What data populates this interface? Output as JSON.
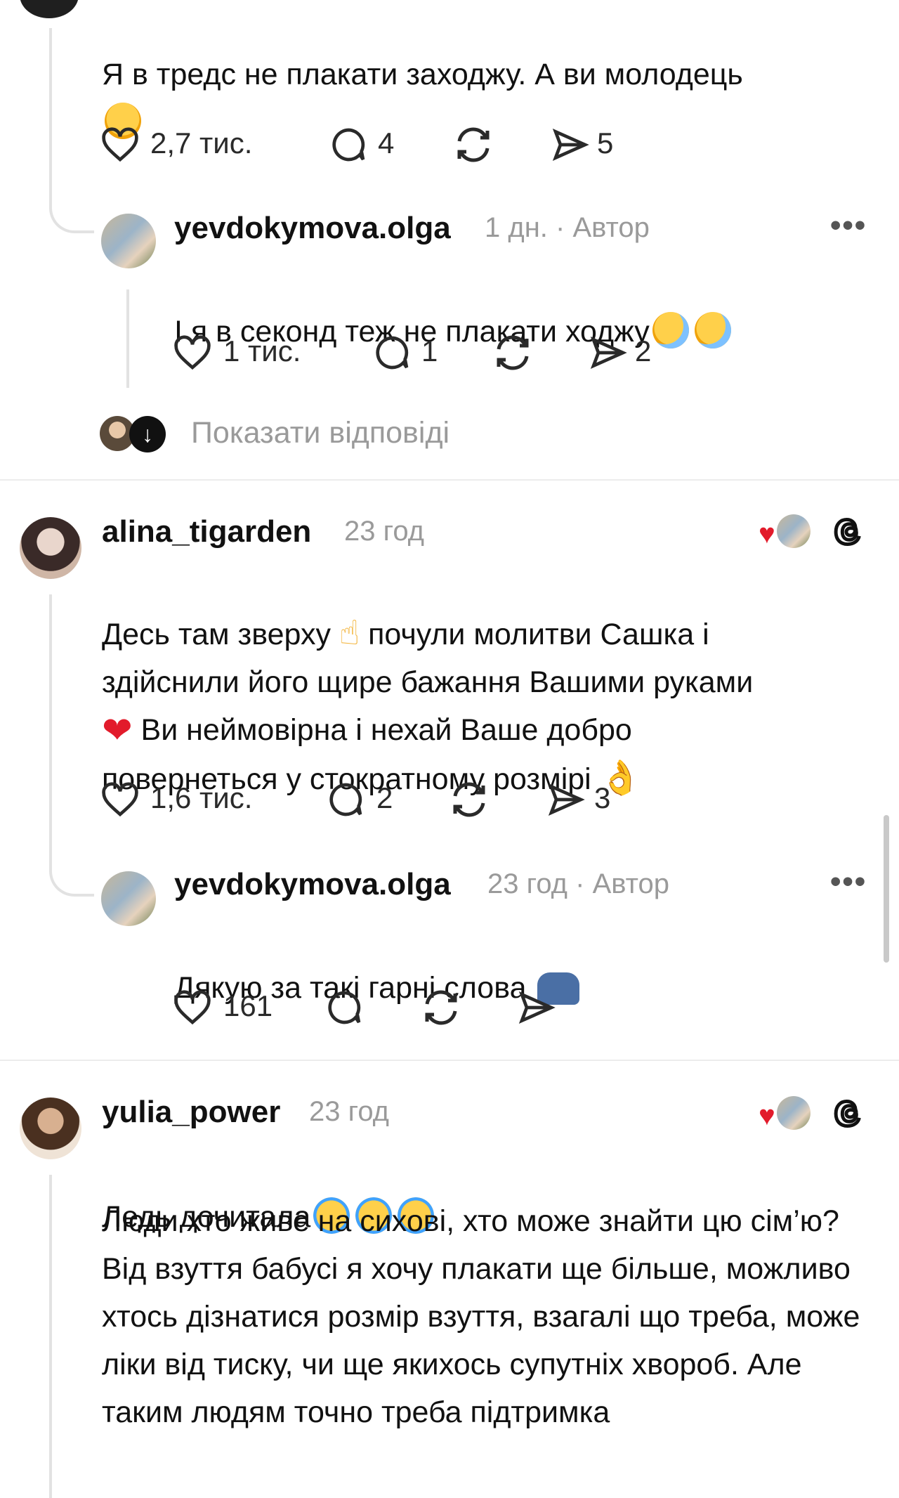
{
  "comment0": {
    "text": "Я в тредс не плакати заходжу. А ви молодець",
    "likes": "2,7 тис.",
    "replies": "4",
    "shares": "5"
  },
  "reply0": {
    "username": "yevdokymova.olga",
    "time": "1 дн.",
    "sep": "·",
    "badge": "Автор",
    "text": "І я в секонд теж не плакати ходжу",
    "likes": "1 тис.",
    "replies": "1",
    "shares": "2"
  },
  "show_replies": "Показати відповіді",
  "comment1": {
    "username": "alina_tigarden",
    "time": "23 год",
    "text1": "Десь там зверху",
    "text2": "почули молитви Сашка і",
    "text3": "здійснили його щире бажання Вашими руками",
    "text4": "Ви неймовірна і нехай Ваше добро",
    "text5": "повернеться у стократному розмірі",
    "likes": "1,6 тис.",
    "replies": "2",
    "shares": "3"
  },
  "reply1": {
    "username": "yevdokymova.olga",
    "time": "23 год",
    "sep": "·",
    "badge": "Автор",
    "text": "Дякую за такі гарні слова",
    "likes": "161"
  },
  "comment2": {
    "username": "yulia_power",
    "time": "23 год",
    "text1": "Ледь дочитала",
    "text2": "Люди хто живе на сихові, хто може знайти цю сім’ю? Від взуття бабусі я хочу плакати ще більше, можливо хтось дізнатися розмір взуття, взагалі що треба, може ліки від тиску, чи ще якихось супутніх хвороб. Але таким людям точно треба підтримка"
  },
  "colors": {
    "text": "#111111",
    "muted": "#9a9a9a",
    "divider": "#ececec",
    "heart": "#e21b2b"
  }
}
